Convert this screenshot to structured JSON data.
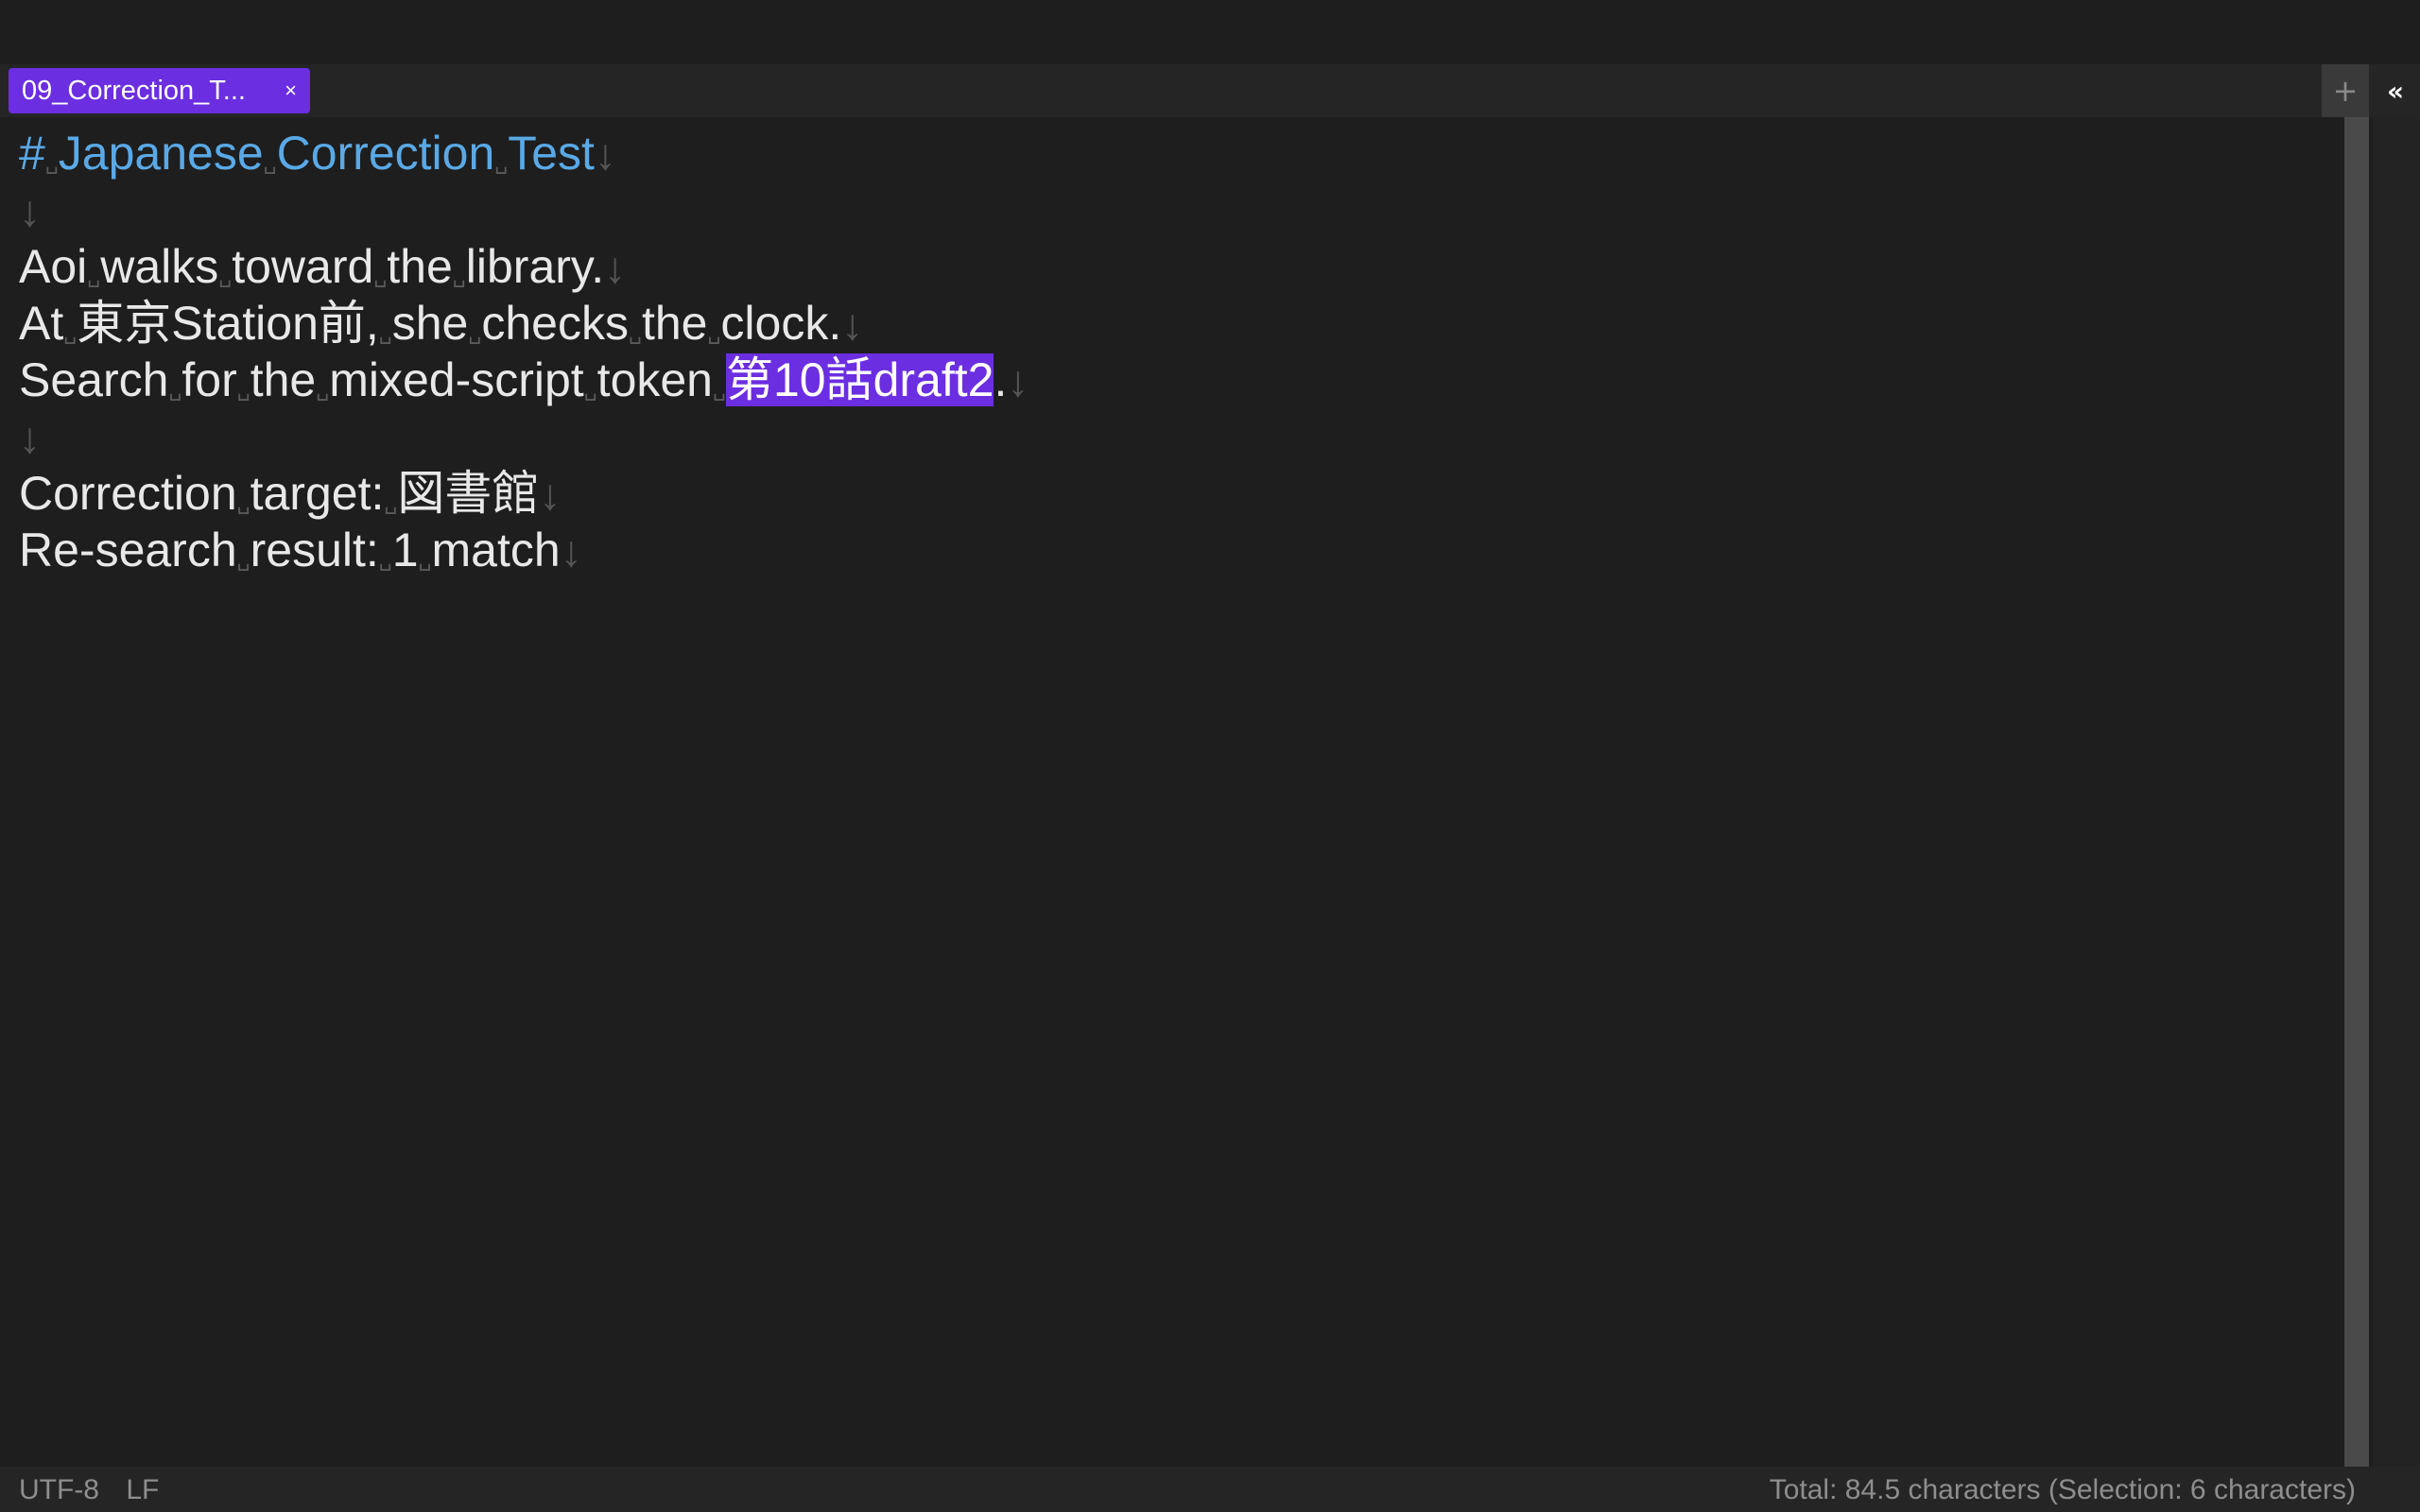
{
  "tab": {
    "label": "09_Correction_T...",
    "close": "×"
  },
  "tabbar": {
    "new_tab": "+",
    "sidebar_toggle": "«"
  },
  "editor": {
    "lines": [
      {
        "parts": [
          {
            "t": "#",
            "c": "heading"
          },
          {
            "t": "␣",
            "c": "ws"
          },
          {
            "t": "Japanese",
            "c": "heading"
          },
          {
            "t": "␣",
            "c": "ws"
          },
          {
            "t": "Correction",
            "c": "heading"
          },
          {
            "t": "␣",
            "c": "ws"
          },
          {
            "t": "Test",
            "c": "heading"
          },
          {
            "t": "↓",
            "c": "lf"
          }
        ]
      },
      {
        "parts": [
          {
            "t": "↓",
            "c": "lf"
          }
        ]
      },
      {
        "parts": [
          {
            "t": "Aoi"
          },
          {
            "t": "␣",
            "c": "ws"
          },
          {
            "t": "walks"
          },
          {
            "t": "␣",
            "c": "ws"
          },
          {
            "t": "toward"
          },
          {
            "t": "␣",
            "c": "ws"
          },
          {
            "t": "the"
          },
          {
            "t": "␣",
            "c": "ws"
          },
          {
            "t": "library."
          },
          {
            "t": "↓",
            "c": "lf"
          }
        ]
      },
      {
        "parts": [
          {
            "t": "At"
          },
          {
            "t": "␣",
            "c": "ws"
          },
          {
            "t": "東京Station前,"
          },
          {
            "t": "␣",
            "c": "ws"
          },
          {
            "t": "she"
          },
          {
            "t": "␣",
            "c": "ws"
          },
          {
            "t": "checks"
          },
          {
            "t": "␣",
            "c": "ws"
          },
          {
            "t": "the"
          },
          {
            "t": "␣",
            "c": "ws"
          },
          {
            "t": "clock."
          },
          {
            "t": "↓",
            "c": "lf"
          }
        ]
      },
      {
        "parts": [
          {
            "t": "Search"
          },
          {
            "t": "␣",
            "c": "ws"
          },
          {
            "t": "for"
          },
          {
            "t": "␣",
            "c": "ws"
          },
          {
            "t": "the"
          },
          {
            "t": "␣",
            "c": "ws"
          },
          {
            "t": "mixed-script"
          },
          {
            "t": "␣",
            "c": "ws"
          },
          {
            "t": "token"
          },
          {
            "t": "␣",
            "c": "ws"
          },
          {
            "t": "第10話draft2",
            "c": "highlight"
          },
          {
            "t": "."
          },
          {
            "t": "↓",
            "c": "lf"
          }
        ]
      },
      {
        "parts": [
          {
            "t": "↓",
            "c": "lf"
          }
        ]
      },
      {
        "parts": [
          {
            "t": "Correction"
          },
          {
            "t": "␣",
            "c": "ws"
          },
          {
            "t": "target:"
          },
          {
            "t": "␣",
            "c": "ws"
          },
          {
            "t": "図書館"
          },
          {
            "t": "↓",
            "c": "lf"
          }
        ]
      },
      {
        "parts": [
          {
            "t": "Re-search"
          },
          {
            "t": "␣",
            "c": "ws"
          },
          {
            "t": "result:"
          },
          {
            "t": "␣",
            "c": "ws"
          },
          {
            "t": "1"
          },
          {
            "t": "␣",
            "c": "ws"
          },
          {
            "t": "match"
          },
          {
            "t": "↓",
            "c": "lf"
          }
        ]
      }
    ]
  },
  "status": {
    "encoding": "UTF-8",
    "line_ending": "LF",
    "summary": "Total: 84.5 characters (Selection: 6 characters)"
  },
  "colors": {
    "accent": "#6b2ee0",
    "heading": "#5aa9e6",
    "background": "#1e1e1e",
    "text": "#e8e8e8"
  }
}
